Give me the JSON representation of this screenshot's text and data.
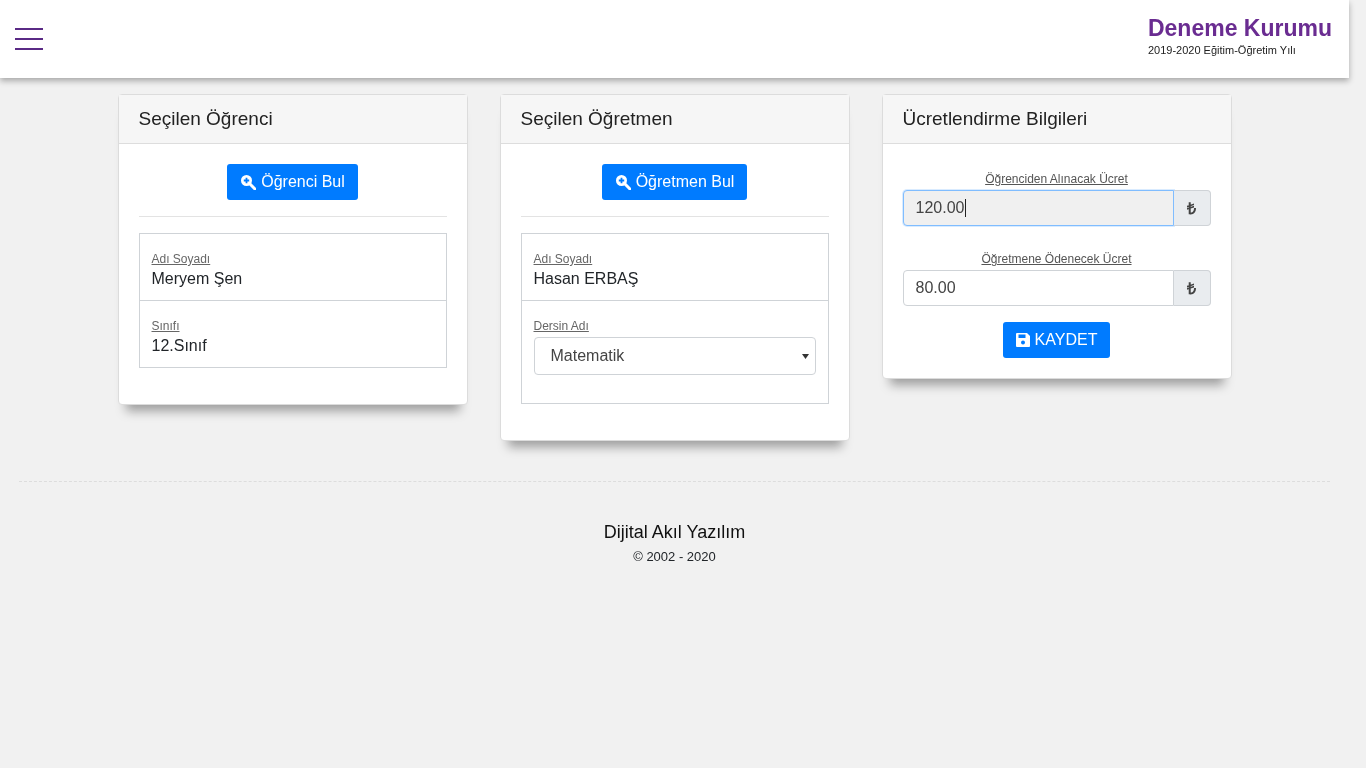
{
  "header": {
    "title": "Deneme Kurumu",
    "subtitle": "2019-2020 Eğitim-Öğretim Yılı"
  },
  "cards": [
    {
      "kind": "lookup",
      "title": "Seçilen Öğrenci",
      "button": "Öğrenci Bul",
      "fields": [
        {
          "kind": "text",
          "label": "Adı Soyadı",
          "value": "Meryem Şen"
        },
        {
          "kind": "text",
          "label": "Sınıfı",
          "value": "12.Sınıf"
        }
      ]
    },
    {
      "kind": "lookup",
      "title": "Seçilen Öğretmen",
      "button": "Öğretmen Bul",
      "fields": [
        {
          "kind": "text",
          "label": "Adı Soyadı",
          "value": "Hasan ERBAŞ"
        },
        {
          "kind": "select",
          "label": "Dersin Adı",
          "value": "Matematik"
        }
      ]
    },
    {
      "kind": "pricing",
      "title": "Ücretlendirme Bilgileri",
      "button": "KAYDET",
      "inputs": [
        {
          "label": "Öğrenciden Alınacak Ücret",
          "value": "120.00",
          "unit": "₺",
          "focused": true
        },
        {
          "label": "Öğretmene Ödenecek Ücret",
          "value": "80.00",
          "unit": "₺",
          "focused": false
        }
      ]
    }
  ],
  "footer": {
    "company": "Dijital Akıl Yazılım",
    "copyright": "© 2002 - 2020"
  }
}
